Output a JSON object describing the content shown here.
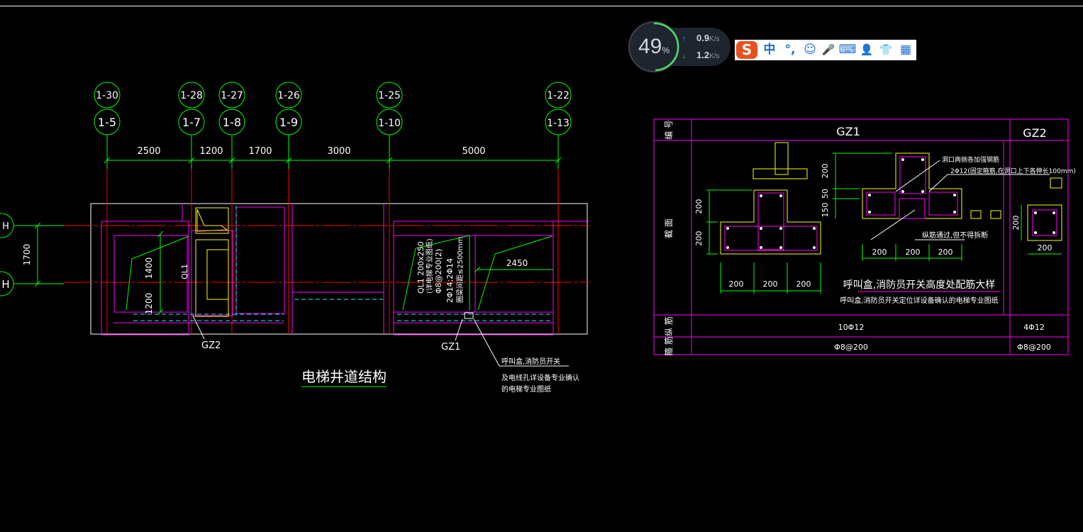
{
  "drawing": {
    "axis_top_labels": [
      "1-30",
      "1-28",
      "1-27",
      "1-26",
      "1-25",
      "1-22"
    ],
    "axis_bottom_labels": [
      "1-5",
      "1-7",
      "1-8",
      "1-9",
      "1-10",
      "1-13"
    ],
    "dimensions": [
      "2500",
      "1200",
      "1700",
      "3000",
      "5000"
    ],
    "left_axis_labels": [
      "H",
      "H"
    ],
    "left_dimension": "1700",
    "plan_dims": {
      "d1400": "1400",
      "d1200": "1200",
      "d2450": "2450"
    },
    "beam_label": "QL1",
    "beam_note_lines": [
      "QL1 200x250",
      "(详电梯专业图纸)",
      "Φ8@200(2)",
      "2Φ14;2Φ14",
      "圈梁间距≤2500mm"
    ],
    "gz2_label": "GZ2",
    "gz1_label": "GZ1",
    "callout_lines": [
      "呼叫盒,消防员开关",
      "及电线孔详设备专业确认",
      "的电梯专业图纸"
    ],
    "plan_title": "电梯井道结构"
  },
  "table": {
    "header_bianhao": "编 号",
    "header_gz1": "GZ1",
    "header_gz2": "GZ2",
    "row_section": "截 面",
    "row_longitudinal": "纵 筋",
    "row_stirrup": "箍 筋",
    "gz1_longitudinal": "10Φ12",
    "gz2_longitudinal": "4Φ12",
    "gz1_stirrup": "Φ8@200",
    "gz2_stirrup": "Φ8@200",
    "section_dims": {
      "d200": "200",
      "d150": "150",
      "d50": "50"
    },
    "note_hole": "洞口两侧各加强钢筋",
    "note_bars": "2Φ12(固定箍筋,在洞口上下各伸长100mm)",
    "note_stirrup": "纵筋通过,但不得拆断",
    "detail_title": "呼叫盒,消防员开关高度处配筋大样",
    "detail_sub": "呼叫盒,消防员开关定位详设备确认的电梯专业图纸"
  },
  "network": {
    "percent": "49",
    "percent_unit": "%",
    "up": "0.9",
    "down": "1.2",
    "unit": "K/s",
    "up_arrow": "↑",
    "down_arrow": "↓"
  },
  "ime": {
    "logo": "S",
    "mode": "中",
    "punct": "°,",
    "emoji": "☺",
    "mic": "🎤",
    "keyboard": "⌨",
    "tools": "👤",
    "skin": "👕",
    "grid": "▦"
  },
  "colors": {
    "green": "#00ff00",
    "red": "#ff0000",
    "magenta": "#ff00ff",
    "yellow": "#ffff00",
    "cyan": "#00ffff",
    "white": "#ffffff"
  }
}
